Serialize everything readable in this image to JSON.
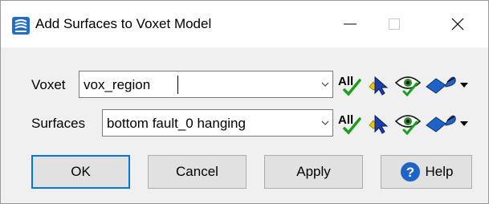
{
  "window": {
    "title": "Add Surfaces to Voxet Model",
    "icon": "voxet-model-icon",
    "controls": [
      "minimize-icon",
      "maximize-icon",
      "close-icon"
    ]
  },
  "form": {
    "voxet": {
      "label": "Voxet",
      "value": "vox_region",
      "tools": [
        "all-select-icon",
        "pick-cursor-icon",
        "visibility-eye-icon",
        "display-style-dropdown-icon"
      ]
    },
    "surfaces": {
      "label": "Surfaces",
      "value": "bottom fault_0 hanging",
      "tools": [
        "all-select-icon",
        "pick-cursor-icon",
        "visibility-eye-icon",
        "display-style-dropdown-icon"
      ]
    },
    "all_text": "All"
  },
  "buttons": {
    "ok": "OK",
    "cancel": "Cancel",
    "apply": "Apply",
    "help": "Help"
  },
  "colors": {
    "accent_border": "#0078d7",
    "check_green": "#1aa01a",
    "help_blue": "#1e64c8"
  }
}
